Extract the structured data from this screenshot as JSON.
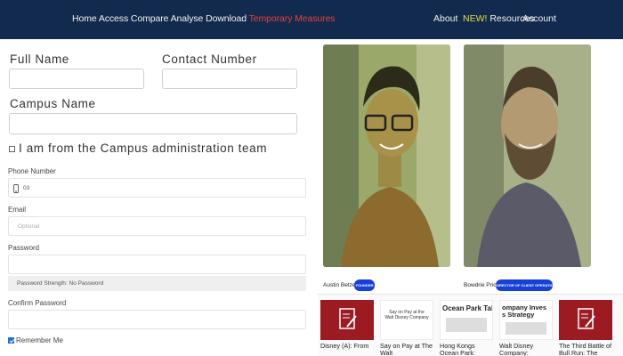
{
  "nav": {
    "left": "Home Access Compare Analyse Download",
    "left_highlight": "Temporary Measures",
    "about": "About",
    "new_badge": "NEW!",
    "resources": "Resources",
    "account": "Account"
  },
  "form": {
    "full_name_label": "Full Name",
    "contact_label": "Contact Number",
    "campus_label": "Campus Name",
    "admin_checkbox_label": "I am from the Campus administration team",
    "phone_label": "Phone Number",
    "phone_value": "03",
    "email_label": "Email",
    "email_placeholder": "Optional",
    "password_label": "Password",
    "strength_text": "Password Strength: No Password",
    "confirm_label": "Confirm Password",
    "remember_label": "Remember Me",
    "remember_checked": true
  },
  "team": [
    {
      "name": "Austin Betzer",
      "role": "FOUNDER"
    },
    {
      "name": "Bowdrie Price",
      "role": "DIRECTOR OF CLIENT OPERATIONS"
    }
  ],
  "cases": [
    {
      "title": "Disney (A): From",
      "thumb": "red",
      "thumb_text": ""
    },
    {
      "title": "Say on Pay at The Walt",
      "thumb": "doc",
      "thumb_text": "Say on Pay at the Walt Disney Company"
    },
    {
      "title": "Hong Kongs Ocean Park:",
      "thumb": "doc",
      "thumb_text": "Ocean Park Tal"
    },
    {
      "title": "Walt Disney Company:",
      "thumb": "doc",
      "thumb_text": "ompany Inves s Strategy"
    },
    {
      "title": "The Third Battle of Bull Run: The",
      "thumb": "red",
      "thumb_text": ""
    }
  ],
  "colors": {
    "nav_bg": "#122a4d",
    "highlight_red": "#e2433a",
    "new_yellow": "#e8df3c",
    "badge_blue": "#1740d8",
    "thumb_red": "#9c1b23"
  }
}
